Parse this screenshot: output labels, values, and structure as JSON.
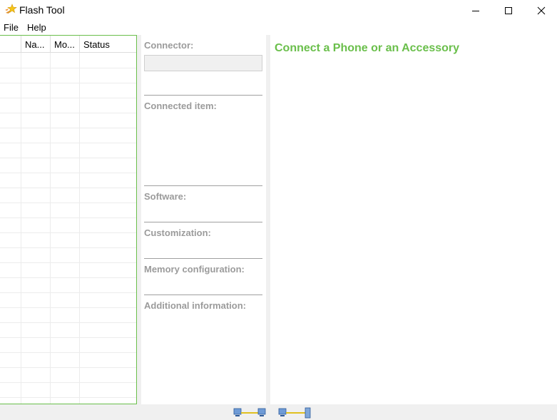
{
  "window": {
    "title": "Flash Tool",
    "icon": "flash-star-icon"
  },
  "menu": {
    "items": [
      {
        "label": "File"
      },
      {
        "label": "Help"
      }
    ]
  },
  "device_table": {
    "columns": [
      "",
      "Na...",
      "Mo...",
      "Status"
    ],
    "rows": []
  },
  "info_panel": {
    "connector_label": "Connector:",
    "connector_value": "",
    "connected_item_label": "Connected item:",
    "software_label": "Software:",
    "customization_label": "Customization:",
    "memory_label": "Memory configuration:",
    "additional_label": "Additional information:"
  },
  "main_panel": {
    "heading": "Connect a Phone or an Accessory"
  },
  "status_bar": {
    "icons": [
      "network-connection-icon",
      "device-connection-icon"
    ]
  },
  "colors": {
    "accent": "#6abf4b",
    "label_gray": "#9b9b9b",
    "background": "#f0f0f0"
  }
}
